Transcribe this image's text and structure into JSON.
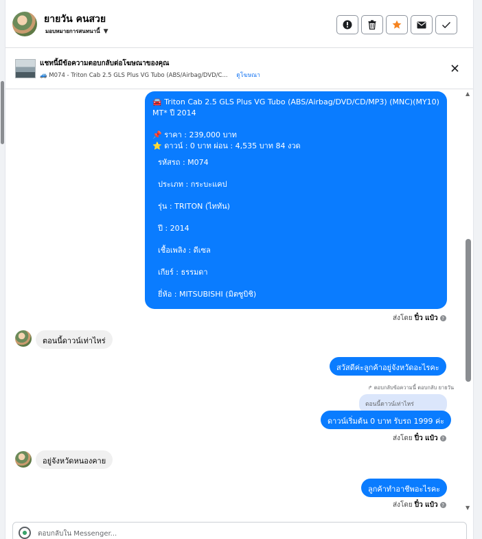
{
  "header": {
    "customer_name": "ยายวัน คนสวย",
    "assign_label": "มอบหมายการสนทนานี้"
  },
  "ad": {
    "title": "แชทนี้มีข้อความตอบกลับต่อโฆษณาของคุณ",
    "car_icon": "🚙",
    "subtitle": "M074 - Triton Cab 2.5 GLS Plus VG Tubo (ABS/Airbag/DVD/C...",
    "view_ad": "ดูโฆษณา"
  },
  "messages": {
    "listing": {
      "title_line1": "🚘 Triton Cab 2.5 GLS Plus VG Tubo (ABS/Airbag/DVD/CD/MP3) (MNC)(MY10)",
      "title_line2": "MT* ปี 2014",
      "price": "📌 ราคา : 239,000 บาท",
      "down": "⭐ ดาวน์ : 0 บาท ผ่อน : 4,535 บาท 84 งวด",
      "specs": [
        "รหัสรถ : M074",
        "ประเภท : กระบะแคป",
        "รุ่น : TRITON (ไททัน)",
        "ปี : 2014",
        "เชื้อเพลิง : ดีเซล",
        "เกียร์ : ธรรมดา",
        "ยี่ห้อ : MITSUBISHI (มิตซูบิชิ)"
      ]
    },
    "sent_by_prefix": "ส่งโดย",
    "sent_by_name": "ปิ๋ว แป๋ว",
    "in1": "ตอนนี้ดาวน์เท่าไหร่",
    "out1": "สวัสดีค่ะลูกค้าอยู่จังหวัดอะไรคะ",
    "reply_note": "ตอบกลับข้อความนี้ ตอบกลับ ยายวัน",
    "quoted": "ตอนนี้ดาวน์เท่าไหร่",
    "out2": "ดาวน์เริ่มต้น 0 บาท รับรถ 1999 ค่ะ",
    "in2": "อยู่จังหวัดหนองคาย",
    "out3": "ลูกค้าทำอาชีพอะไรคะ"
  },
  "composer": {
    "placeholder": "ตอบกลับใน Messenger..."
  },
  "colors": {
    "accent": "#0a7cff",
    "star": "#f5831f"
  }
}
